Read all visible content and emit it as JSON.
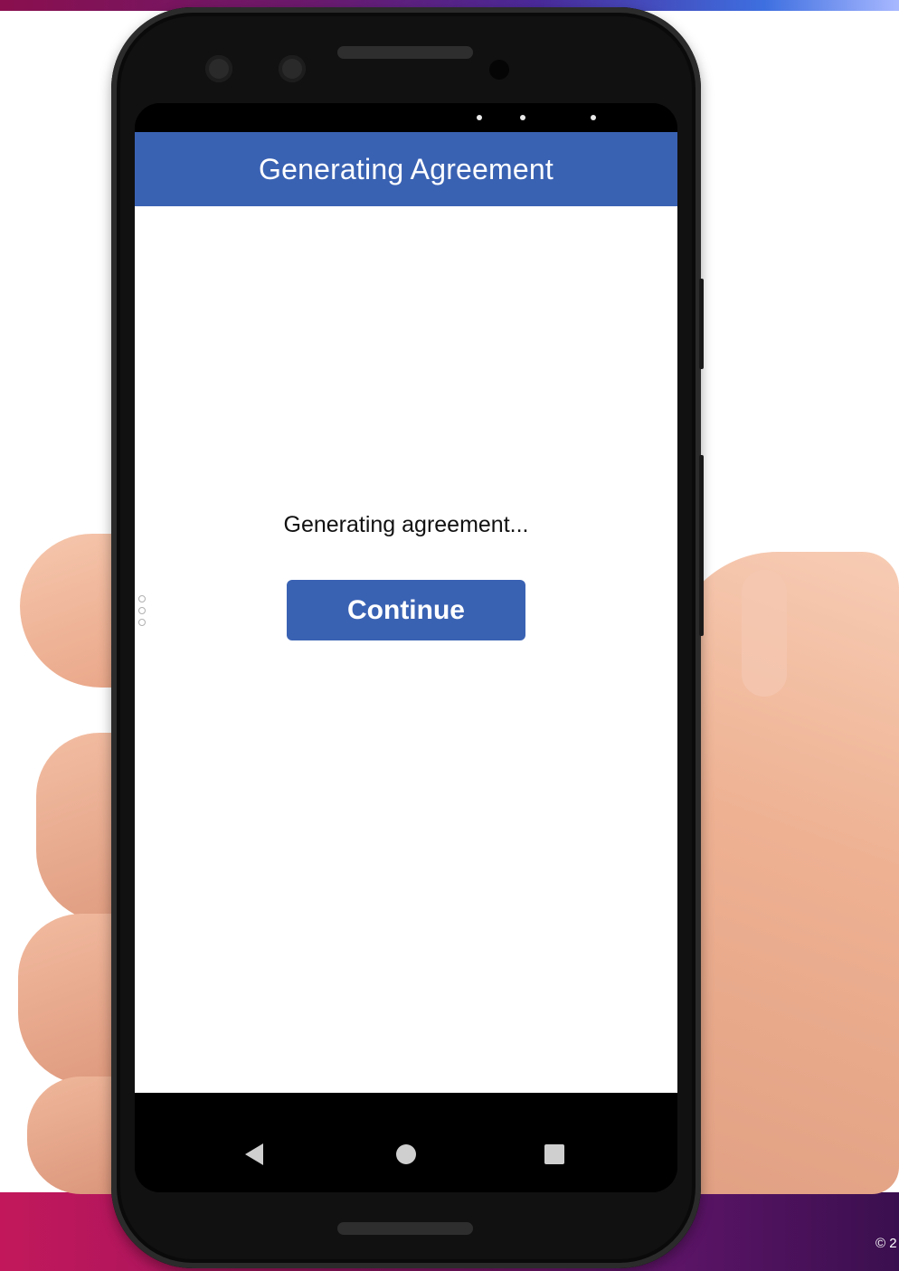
{
  "header": {
    "title": "Generating Agreement"
  },
  "main": {
    "message": "Generating agreement...",
    "continue_label": "Continue"
  },
  "footer": {
    "copyright": "© 2"
  },
  "colors": {
    "header_bg": "#3a62b3",
    "button_bg": "#3a62b3",
    "brand_band": "#a3145e"
  },
  "icons": [
    "back-icon",
    "home-icon",
    "recents-icon"
  ]
}
